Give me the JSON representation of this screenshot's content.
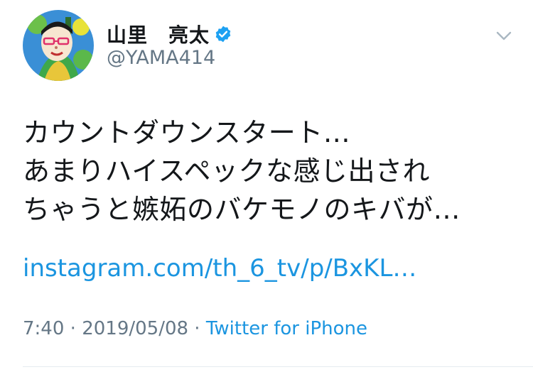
{
  "user": {
    "display_name": "山里　亮太",
    "handle": "@YAMA414",
    "verified_icon": "verified-badge-icon",
    "avatar_icon": "profile-avatar"
  },
  "menu": {
    "icon": "chevron-down-icon"
  },
  "tweet": {
    "lines": [
      "カウントダウンスタート…",
      "あまりハイスペックな感じ出され",
      "ちゃうと嫉妬のバケモノのキバが…"
    ],
    "link": "instagram.com/th_6_tv/p/BxKL…"
  },
  "meta": {
    "time": "7:40",
    "date": "2019/05/08",
    "separator": " · ",
    "source": "Twitter for iPhone"
  },
  "colors": {
    "link": "#1b95e0",
    "verified": "#1da1f2",
    "secondary_text": "#657786"
  }
}
